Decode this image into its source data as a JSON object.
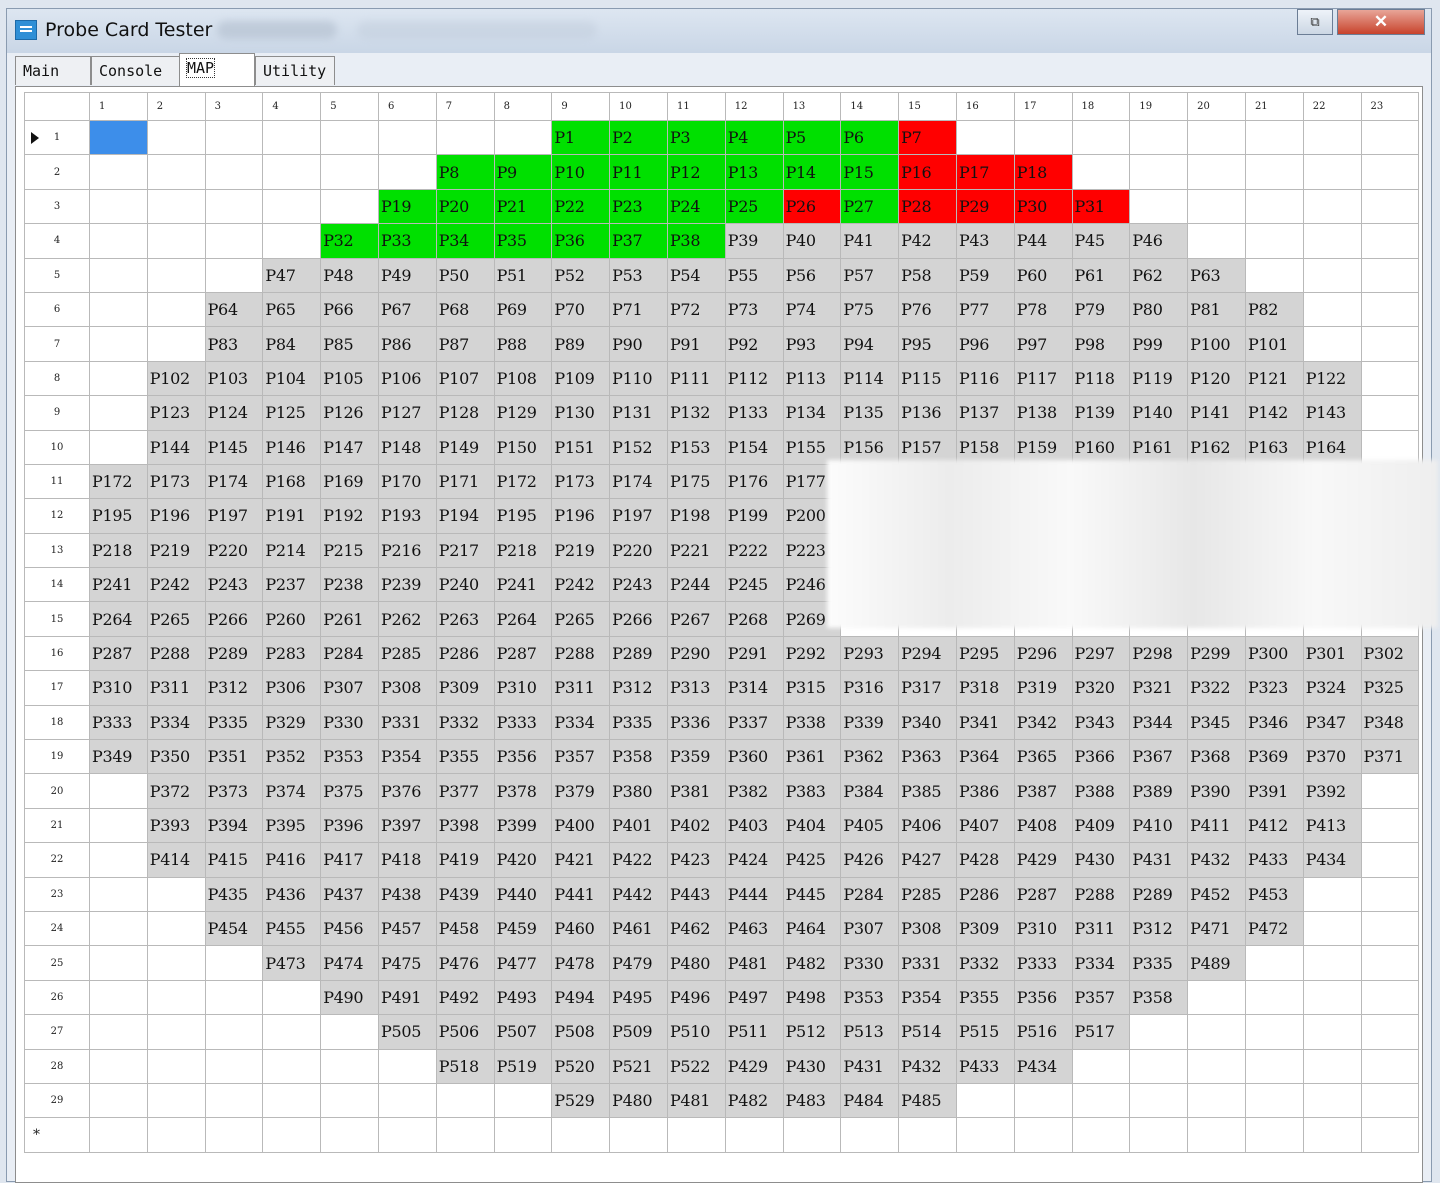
{
  "window": {
    "title": "Probe Card Tester",
    "maximize_glyph": "⧉",
    "close_glyph": "✕",
    "accent_close": "#c8432c"
  },
  "tabs": [
    {
      "label": "Main",
      "active": false
    },
    {
      "label": "Console",
      "active": false
    },
    {
      "label": "MAP",
      "active": true
    },
    {
      "label": "Utility",
      "active": false
    }
  ],
  "grid": {
    "columns": [
      "1",
      "2",
      "3",
      "4",
      "5",
      "6",
      "7",
      "8",
      "9",
      "10",
      "11",
      "12",
      "13",
      "14",
      "15",
      "16",
      "17",
      "18",
      "19",
      "20",
      "21",
      "22",
      "23"
    ],
    "new_row_marker": "*",
    "selected_cell": {
      "row": 1,
      "col": 1
    },
    "colors": {
      "green": "#00e000",
      "red": "#ff0000",
      "gray": "#d4d4d4",
      "selected": "#3d8eea"
    },
    "rows": [
      {
        "h": "1",
        "cells": [
          "",
          "",
          "",
          "",
          "",
          "",
          "",
          "",
          "P1",
          "P2",
          "P3",
          "P4",
          "P5",
          "P6",
          "P7",
          "",
          "",
          "",
          "",
          "",
          "",
          "",
          ""
        ],
        "green": [
          9,
          10,
          11,
          12,
          13,
          14
        ],
        "red": [
          15
        ]
      },
      {
        "h": "2",
        "cells": [
          "",
          "",
          "",
          "",
          "",
          "",
          "P8",
          "P9",
          "P10",
          "P11",
          "P12",
          "P13",
          "P14",
          "P15",
          "P16",
          "P17",
          "P18",
          "",
          "",
          "",
          "",
          "",
          ""
        ],
        "green": [
          7,
          8,
          9,
          10,
          11,
          12,
          13,
          14
        ],
        "red": [
          15,
          16,
          17
        ]
      },
      {
        "h": "3",
        "cells": [
          "",
          "",
          "",
          "",
          "",
          "P19",
          "P20",
          "P21",
          "P22",
          "P23",
          "P24",
          "P25",
          "P26",
          "P27",
          "P28",
          "P29",
          "P30",
          "P31",
          "",
          "",
          "",
          "",
          ""
        ],
        "green": [
          6,
          7,
          8,
          9,
          10,
          11,
          12,
          14
        ],
        "red": [
          13,
          15,
          16,
          17,
          18
        ]
      },
      {
        "h": "4",
        "cells": [
          "",
          "",
          "",
          "",
          "P32",
          "P33",
          "P34",
          "P35",
          "P36",
          "P37",
          "P38",
          "P39",
          "P40",
          "P41",
          "P42",
          "P43",
          "P44",
          "P45",
          "P46",
          "",
          "",
          "",
          ""
        ],
        "green": [
          5,
          6,
          7,
          8,
          9,
          10,
          11
        ],
        "red": []
      },
      {
        "h": "5",
        "cells": [
          "",
          "",
          "",
          "P47",
          "P48",
          "P49",
          "P50",
          "P51",
          "P52",
          "P53",
          "P54",
          "P55",
          "P56",
          "P57",
          "P58",
          "P59",
          "P60",
          "P61",
          "P62",
          "P63",
          "",
          "",
          ""
        ]
      },
      {
        "h": "6",
        "cells": [
          "",
          "",
          "P64",
          "P65",
          "P66",
          "P67",
          "P68",
          "P69",
          "P70",
          "P71",
          "P72",
          "P73",
          "P74",
          "P75",
          "P76",
          "P77",
          "P78",
          "P79",
          "P80",
          "P81",
          "P82",
          "",
          ""
        ]
      },
      {
        "h": "7",
        "cells": [
          "",
          "",
          "P83",
          "P84",
          "P85",
          "P86",
          "P87",
          "P88",
          "P89",
          "P90",
          "P91",
          "P92",
          "P93",
          "P94",
          "P95",
          "P96",
          "P97",
          "P98",
          "P99",
          "P100",
          "P101",
          "",
          ""
        ]
      },
      {
        "h": "8",
        "cells": [
          "",
          "P102",
          "P103",
          "P104",
          "P105",
          "P106",
          "P107",
          "P108",
          "P109",
          "P110",
          "P111",
          "P112",
          "P113",
          "P114",
          "P115",
          "P116",
          "P117",
          "P118",
          "P119",
          "P120",
          "P121",
          "P122",
          ""
        ]
      },
      {
        "h": "9",
        "cells": [
          "",
          "P123",
          "P124",
          "P125",
          "P126",
          "P127",
          "P128",
          "P129",
          "P130",
          "P131",
          "P132",
          "P133",
          "P134",
          "P135",
          "P136",
          "P137",
          "P138",
          "P139",
          "P140",
          "P141",
          "P142",
          "P143",
          ""
        ]
      },
      {
        "h": "10",
        "cells": [
          "",
          "P144",
          "P145",
          "P146",
          "P147",
          "P148",
          "P149",
          "P150",
          "P151",
          "P152",
          "P153",
          "P154",
          "P155",
          "P156",
          "P157",
          "P158",
          "P159",
          "P160",
          "P161",
          "P162",
          "P163",
          "P164",
          ""
        ]
      },
      {
        "h": "11",
        "cells": [
          "P172",
          "P173",
          "P174",
          "P168",
          "P169",
          "P170",
          "P171",
          "P172",
          "P173",
          "P174",
          "P175",
          "P176",
          "P177",
          "",
          "",
          "",
          "",
          "",
          "",
          "",
          "",
          "",
          ""
        ]
      },
      {
        "h": "12",
        "cells": [
          "P195",
          "P196",
          "P197",
          "P191",
          "P192",
          "P193",
          "P194",
          "P195",
          "P196",
          "P197",
          "P198",
          "P199",
          "P200",
          "",
          "",
          "",
          "",
          "",
          "",
          "",
          "",
          "",
          ""
        ]
      },
      {
        "h": "13",
        "cells": [
          "P218",
          "P219",
          "P220",
          "P214",
          "P215",
          "P216",
          "P217",
          "P218",
          "P219",
          "P220",
          "P221",
          "P222",
          "P223",
          "",
          "",
          "",
          "",
          "",
          "",
          "",
          "",
          "",
          ""
        ]
      },
      {
        "h": "14",
        "cells": [
          "P241",
          "P242",
          "P243",
          "P237",
          "P238",
          "P239",
          "P240",
          "P241",
          "P242",
          "P243",
          "P244",
          "P245",
          "P246",
          "",
          "",
          "",
          "",
          "",
          "",
          "",
          "",
          "",
          ""
        ]
      },
      {
        "h": "15",
        "cells": [
          "P264",
          "P265",
          "P266",
          "P260",
          "P261",
          "P262",
          "P263",
          "P264",
          "P265",
          "P266",
          "P267",
          "P268",
          "P269",
          "",
          "",
          "",
          "",
          "",
          "",
          "",
          "",
          "",
          ""
        ]
      },
      {
        "h": "16",
        "cells": [
          "P287",
          "P288",
          "P289",
          "P283",
          "P284",
          "P285",
          "P286",
          "P287",
          "P288",
          "P289",
          "P290",
          "P291",
          "P292",
          "P293",
          "P294",
          "P295",
          "P296",
          "P297",
          "P298",
          "P299",
          "P300",
          "P301",
          "P302"
        ]
      },
      {
        "h": "17",
        "cells": [
          "P310",
          "P311",
          "P312",
          "P306",
          "P307",
          "P308",
          "P309",
          "P310",
          "P311",
          "P312",
          "P313",
          "P314",
          "P315",
          "P316",
          "P317",
          "P318",
          "P319",
          "P320",
          "P321",
          "P322",
          "P323",
          "P324",
          "P325"
        ]
      },
      {
        "h": "18",
        "cells": [
          "P333",
          "P334",
          "P335",
          "P329",
          "P330",
          "P331",
          "P332",
          "P333",
          "P334",
          "P335",
          "P336",
          "P337",
          "P338",
          "P339",
          "P340",
          "P341",
          "P342",
          "P343",
          "P344",
          "P345",
          "P346",
          "P347",
          "P348"
        ]
      },
      {
        "h": "19",
        "cells": [
          "P349",
          "P350",
          "P351",
          "P352",
          "P353",
          "P354",
          "P355",
          "P356",
          "P357",
          "P358",
          "P359",
          "P360",
          "P361",
          "P362",
          "P363",
          "P364",
          "P365",
          "P366",
          "P367",
          "P368",
          "P369",
          "P370",
          "P371"
        ]
      },
      {
        "h": "20",
        "cells": [
          "",
          "P372",
          "P373",
          "P374",
          "P375",
          "P376",
          "P377",
          "P378",
          "P379",
          "P380",
          "P381",
          "P382",
          "P383",
          "P384",
          "P385",
          "P386",
          "P387",
          "P388",
          "P389",
          "P390",
          "P391",
          "P392",
          ""
        ]
      },
      {
        "h": "21",
        "cells": [
          "",
          "P393",
          "P394",
          "P395",
          "P396",
          "P397",
          "P398",
          "P399",
          "P400",
          "P401",
          "P402",
          "P403",
          "P404",
          "P405",
          "P406",
          "P407",
          "P408",
          "P409",
          "P410",
          "P411",
          "P412",
          "P413",
          ""
        ]
      },
      {
        "h": "22",
        "cells": [
          "",
          "P414",
          "P415",
          "P416",
          "P417",
          "P418",
          "P419",
          "P420",
          "P421",
          "P422",
          "P423",
          "P424",
          "P425",
          "P426",
          "P427",
          "P428",
          "P429",
          "P430",
          "P431",
          "P432",
          "P433",
          "P434",
          ""
        ]
      },
      {
        "h": "23",
        "cells": [
          "",
          "",
          "P435",
          "P436",
          "P437",
          "P438",
          "P439",
          "P440",
          "P441",
          "P442",
          "P443",
          "P444",
          "P445",
          "P284",
          "P285",
          "P286",
          "P287",
          "P288",
          "P289",
          "P452",
          "P453",
          "",
          ""
        ]
      },
      {
        "h": "24",
        "cells": [
          "",
          "",
          "P454",
          "P455",
          "P456",
          "P457",
          "P458",
          "P459",
          "P460",
          "P461",
          "P462",
          "P463",
          "P464",
          "P307",
          "P308",
          "P309",
          "P310",
          "P311",
          "P312",
          "P471",
          "P472",
          "",
          ""
        ]
      },
      {
        "h": "25",
        "cells": [
          "",
          "",
          "",
          "P473",
          "P474",
          "P475",
          "P476",
          "P477",
          "P478",
          "P479",
          "P480",
          "P481",
          "P482",
          "P330",
          "P331",
          "P332",
          "P333",
          "P334",
          "P335",
          "P489",
          "",
          "",
          ""
        ]
      },
      {
        "h": "26",
        "cells": [
          "",
          "",
          "",
          "",
          "P490",
          "P491",
          "P492",
          "P493",
          "P494",
          "P495",
          "P496",
          "P497",
          "P498",
          "P353",
          "P354",
          "P355",
          "P356",
          "P357",
          "P358",
          "",
          "",
          "",
          ""
        ]
      },
      {
        "h": "27",
        "cells": [
          "",
          "",
          "",
          "",
          "",
          "P505",
          "P506",
          "P507",
          "P508",
          "P509",
          "P510",
          "P511",
          "P512",
          "P513",
          "P514",
          "P515",
          "P516",
          "P517",
          "",
          "",
          "",
          "",
          ""
        ]
      },
      {
        "h": "28",
        "cells": [
          "",
          "",
          "",
          "",
          "",
          "",
          "P518",
          "P519",
          "P520",
          "P521",
          "P522",
          "P429",
          "P430",
          "P431",
          "P432",
          "P433",
          "P434",
          "",
          "",
          "",
          "",
          "",
          ""
        ]
      },
      {
        "h": "29",
        "cells": [
          "",
          "",
          "",
          "",
          "",
          "",
          "",
          "",
          "P529",
          "P480",
          "P481",
          "P482",
          "P483",
          "P484",
          "P485",
          "",
          "",
          "",
          "",
          "",
          "",
          "",
          ""
        ]
      }
    ]
  }
}
